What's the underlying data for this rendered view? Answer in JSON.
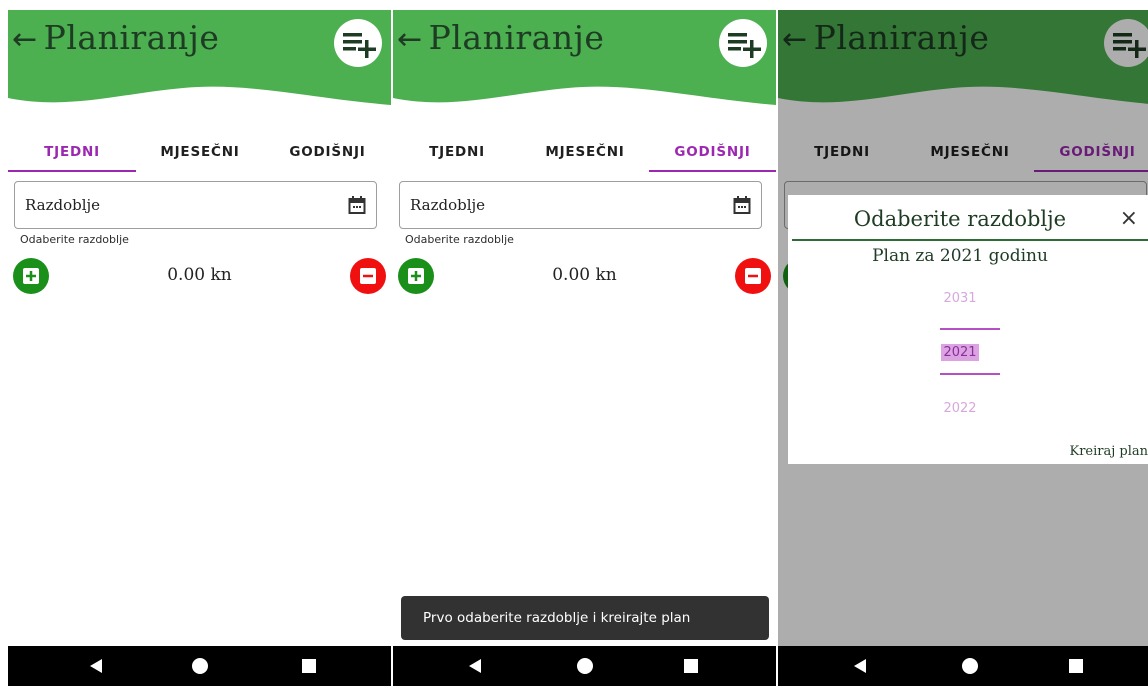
{
  "app": {
    "title": "Planiranje",
    "back_icon": "←",
    "theme_green": "#4caf50",
    "accent": "#9c27b0"
  },
  "tabs": [
    "TJEDNI",
    "MJESEČNI",
    "GODIŠNJI"
  ],
  "screens": [
    {
      "active_tab": "TJEDNI"
    },
    {
      "active_tab": "GODIŠNJI"
    },
    {
      "active_tab": "GODIŠNJI"
    }
  ],
  "period_field": {
    "label": "Razdoblje",
    "helper": "Odaberite razdoblje",
    "icon": "calendar-icon"
  },
  "amount": "0.00 kn",
  "snackbar": "Prvo odaberite razdoblje i kreirajte plan",
  "dialog": {
    "title": "Odaberite razdoblje",
    "close": "×",
    "subtitle": "Plan za 2021 godinu",
    "year_prev": "2031",
    "year_selected": "2021",
    "year_next": "2022",
    "action": "Kreiraj plan"
  },
  "icons": {
    "add_plan": "playlist-add-icon",
    "add": "plus-box-icon",
    "subtract": "minus-box-icon",
    "nav_back": "nav-back-icon",
    "nav_home": "nav-home-icon",
    "nav_recent": "nav-recent-icon"
  }
}
